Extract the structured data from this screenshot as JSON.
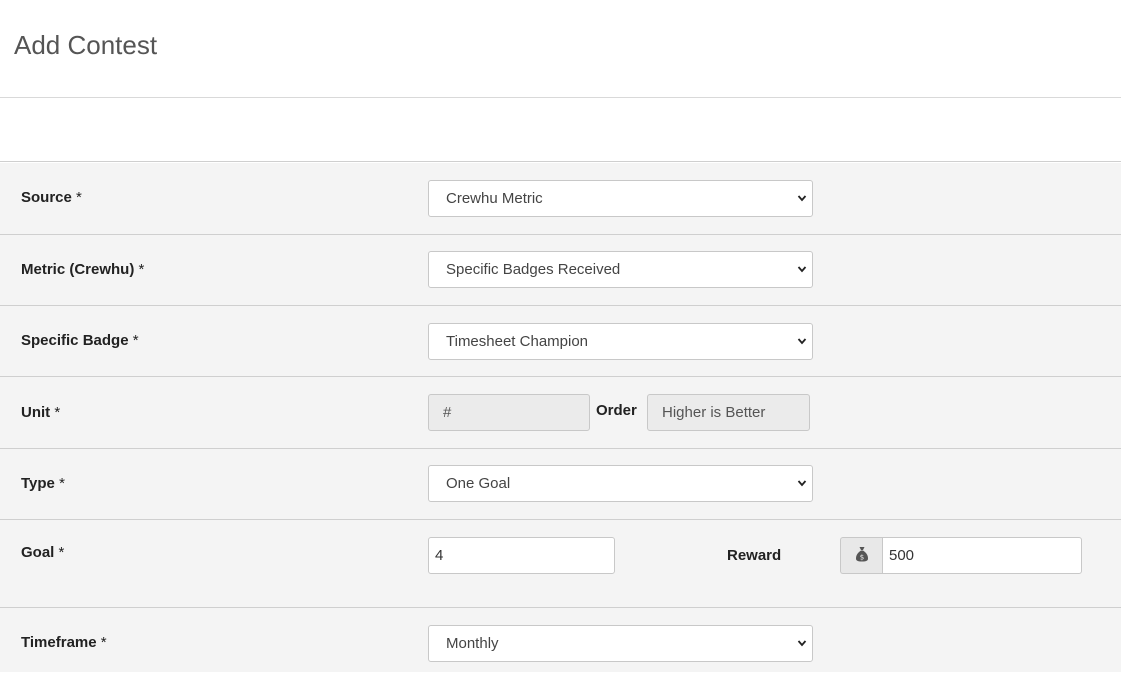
{
  "header": {
    "title": "Add Contest"
  },
  "form": {
    "source": {
      "label": "Source",
      "required": "*",
      "value": "Crewhu Metric"
    },
    "metric": {
      "label": "Metric (Crewhu)",
      "required": "*",
      "value": "Specific Badges Received"
    },
    "badge": {
      "label": "Specific Badge",
      "required": "*",
      "value": "Timesheet Champion"
    },
    "unit": {
      "label": "Unit",
      "required": "*",
      "value": "#",
      "order_label": "Order",
      "order_value": "Higher is Better"
    },
    "type": {
      "label": "Type",
      "required": "*",
      "value": "One Goal"
    },
    "goal": {
      "label": "Goal",
      "required": "*",
      "value": "4",
      "reward_label": "Reward",
      "reward_icon": "money-bag-icon",
      "reward_value": "500"
    },
    "timeframe": {
      "label": "Timeframe",
      "required": "*",
      "value": "Monthly"
    }
  },
  "icons": {
    "select_chevron": "chevron-down-icon"
  }
}
